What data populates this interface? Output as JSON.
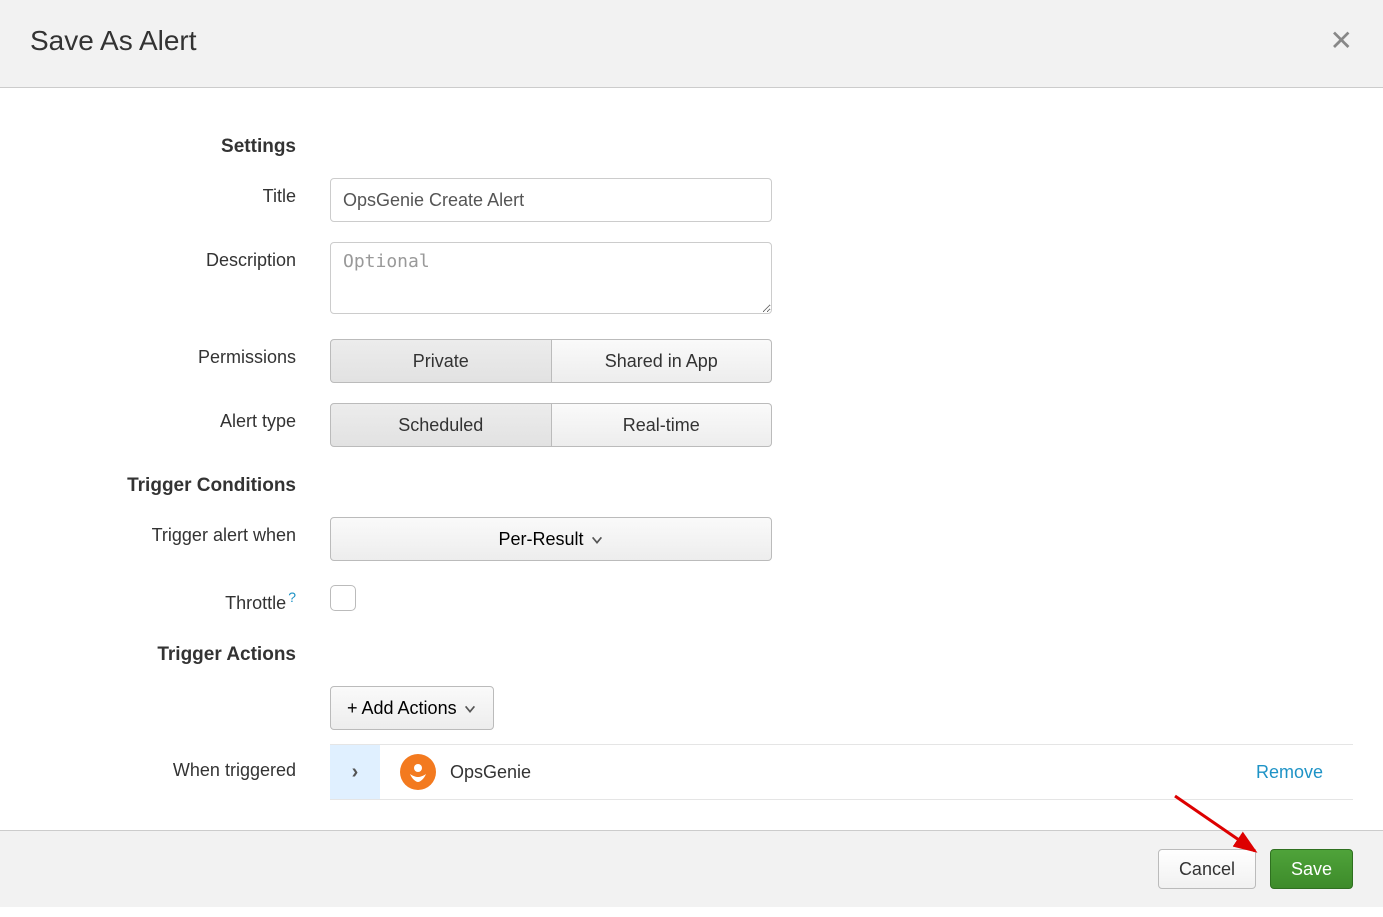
{
  "dialog": {
    "title": "Save As Alert",
    "sections": {
      "settings_label": "Settings",
      "trigger_conditions_label": "Trigger Conditions",
      "trigger_actions_label": "Trigger Actions"
    },
    "fields": {
      "title_label": "Title",
      "title_value": "OpsGenie Create Alert",
      "description_label": "Description",
      "description_placeholder": "Optional",
      "permissions_label": "Permissions",
      "permissions_options": {
        "private": "Private",
        "shared": "Shared in App"
      },
      "alert_type_label": "Alert type",
      "alert_type_options": {
        "scheduled": "Scheduled",
        "realtime": "Real-time"
      },
      "trigger_when_label": "Trigger alert when",
      "trigger_when_value": "Per-Result",
      "throttle_label": "Throttle",
      "throttle_help": "?",
      "add_actions_label": "+ Add Actions",
      "when_triggered_label": "When triggered"
    },
    "action_item": {
      "name": "OpsGenie",
      "remove_label": "Remove",
      "icon": "opsgenie-icon"
    },
    "footer": {
      "cancel": "Cancel",
      "save": "Save"
    }
  }
}
